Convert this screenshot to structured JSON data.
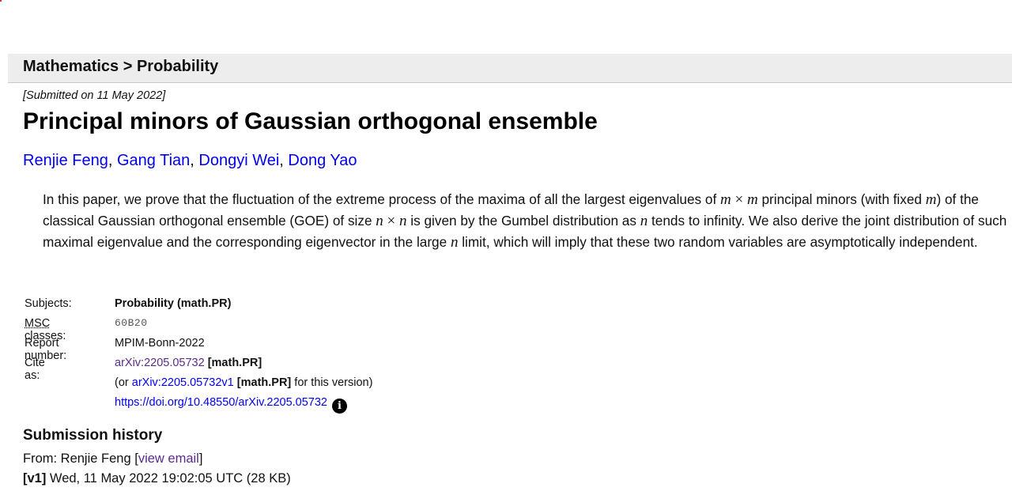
{
  "breadcrumb": "Mathematics > Probability",
  "submitted": "[Submitted on 11 May 2022]",
  "title": "Principal minors of Gaussian orthogonal ensemble",
  "authors": [
    "Renjie Feng",
    "Gang Tian",
    "Dongyi Wei",
    "Dong Yao"
  ],
  "abstract": {
    "p1": "In this paper, we prove that the fluctuation of the extreme process of the maxima of all the largest eigenvalues of ",
    "v_m1": "m",
    "times1": " × ",
    "v_m2": "m",
    "p2": " principal minors (with fixed ",
    "v_m3": "m",
    "p3": ") of the classical Gaussian orthogonal ensemble (GOE) of size ",
    "v_n1": "n",
    "times2": " × ",
    "v_n2": "n",
    "p4": " is given by the Gumbel distribution as ",
    "v_n3": "n",
    "p5": " tends to infinity. We also derive the joint distribution of such maximal eigenvalue and the corresponding eigenvector in the large ",
    "v_n4": "n",
    "p6": " limit, which will imply that these two random variables are asymptotically independent."
  },
  "meta": {
    "subjects_label": "Subjects:",
    "subjects_value": "Probability (math.PR)",
    "msc_abbr": "MSC",
    "msc_label_rest": " classes:",
    "msc_value": "60B20",
    "report_label": "Report number:",
    "report_value": "MPIM-Bonn-2022",
    "cite_label": "Cite as:",
    "cite_link": "arXiv:2205.05732",
    "cite_tag": "[math.PR]",
    "version_open": "(or ",
    "version_link": "arXiv:2205.05732v1",
    "version_tag": "[math.PR]",
    "version_close": " for this version)",
    "doi_link": "https://doi.org/10.48550/arXiv.2205.05732",
    "info_glyph": "i"
  },
  "history": {
    "title": "Submission history",
    "from_prefix": "From: Renjie Feng [",
    "view_email": "view email",
    "from_suffix": "]",
    "v1_label": "[v1]",
    "v1_text": " Wed, 11 May 2022 19:02:05 UTC (28 KB)"
  },
  "colors": {
    "link": "#0000ee",
    "visited": "#5a2a8a",
    "header_bg": "#ededed"
  },
  "icons": {
    "doi_info": "info-circle-icon"
  }
}
